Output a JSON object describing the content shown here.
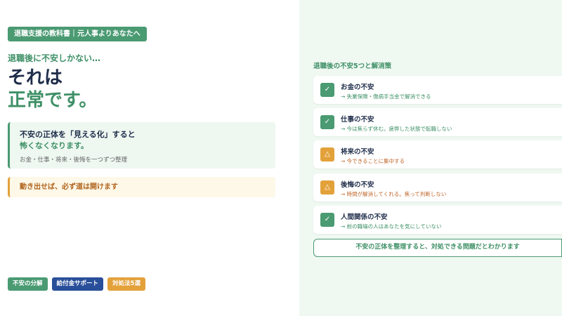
{
  "header": {
    "tag": "退職支援の教科書｜元人事よりあなたへ",
    "subtitle": "退職後に不安しかない…",
    "headline_1": "それは",
    "headline_2": "正常です。"
  },
  "info_box": {
    "line1": "不安の正体を「見える化」すると",
    "line2": "怖くなくなります。",
    "line3": "お金・仕事・将来・後悔を一つずつ整理"
  },
  "note_box": {
    "text": "動き出せば、必ず道は開けます"
  },
  "chips": [
    {
      "label": "不安の分解",
      "color": "#4a9a72"
    },
    {
      "label": "給付金サポート",
      "color": "#2a4f9a"
    },
    {
      "label": "対処法5選",
      "color": "#e3a13a"
    }
  ],
  "list": {
    "title": "退職後の不安5つと解消策",
    "items": [
      {
        "title": "お金の不安",
        "desc": "→ 失業保険・傷病手当金で解消できる",
        "icon": "check-icon",
        "glyph": "✓",
        "status": "ok"
      },
      {
        "title": "仕事の不安",
        "desc": "→ 今は焦らず休む。疲弊した状態で転職しない",
        "icon": "check-icon",
        "glyph": "✓",
        "status": "ok"
      },
      {
        "title": "将来の不安",
        "desc": "→ 今できることに集中する",
        "icon": "warning-icon",
        "glyph": "△",
        "status": "warn"
      },
      {
        "title": "後悔の不安",
        "desc": "→ 時間が解消してくれる。焦って判断しない",
        "icon": "warning-icon",
        "glyph": "△",
        "status": "warn"
      },
      {
        "title": "人間関係の不安",
        "desc": "→ 前の職場の人はあなたを気にしていない",
        "icon": "check-icon",
        "glyph": "✓",
        "status": "ok"
      }
    ],
    "footer": "不安の正体を整理すると、対処できる問題だとわかります"
  },
  "colors": {
    "brand_green": "#4a9a72",
    "navy": "#1f2d4a",
    "orange": "#e3a13a",
    "blue": "#2a4f9a"
  }
}
